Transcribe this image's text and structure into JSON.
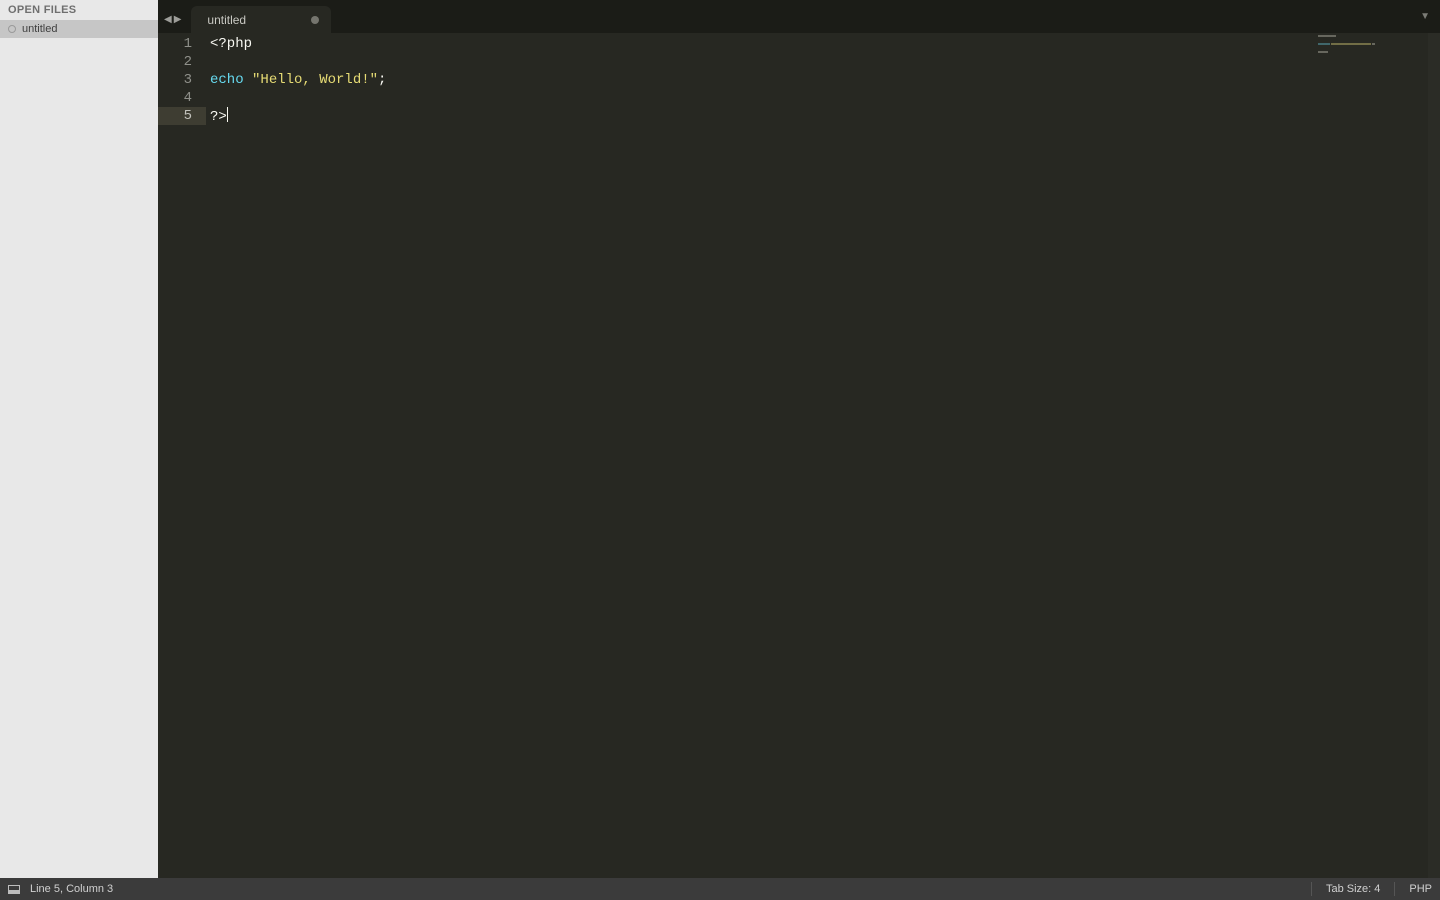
{
  "sidebar": {
    "header": "OPEN FILES",
    "files": [
      {
        "name": "untitled",
        "dirty": true
      }
    ]
  },
  "tabs": {
    "active": 0,
    "items": [
      {
        "title": "untitled",
        "dirty": true
      }
    ]
  },
  "editor": {
    "active_line": 5,
    "lines": [
      {
        "n": 1,
        "tokens": [
          {
            "t": "<?php",
            "c": "tag"
          }
        ]
      },
      {
        "n": 2,
        "tokens": [
          {
            "t": "",
            "c": "plain"
          }
        ]
      },
      {
        "n": 3,
        "tokens": [
          {
            "t": "echo",
            "c": "kw"
          },
          {
            "t": " ",
            "c": "plain"
          },
          {
            "t": "\"Hello, World!\"",
            "c": "str"
          },
          {
            "t": ";",
            "c": "punc"
          }
        ]
      },
      {
        "n": 4,
        "tokens": [
          {
            "t": "",
            "c": "plain"
          }
        ]
      },
      {
        "n": 5,
        "tokens": [
          {
            "t": "?>",
            "c": "tag"
          }
        ],
        "caret_after": true
      }
    ]
  },
  "status": {
    "position": "Line 5, Column 3",
    "tab_size": "Tab Size: 4",
    "language": "PHP"
  },
  "icons": {
    "nav_prev": "◀",
    "nav_next": "▶",
    "tab_menu": "▼"
  }
}
